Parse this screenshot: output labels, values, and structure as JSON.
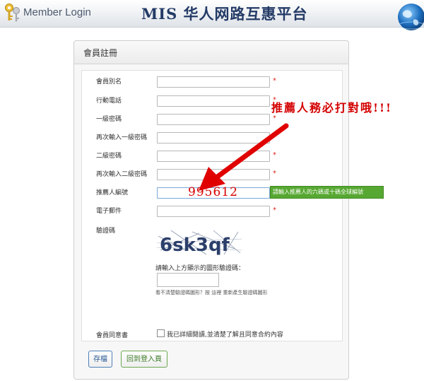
{
  "header": {
    "brand": "Member Login",
    "title": "MIS 华人网路互惠平台"
  },
  "panel": {
    "title": "會員註冊"
  },
  "form": {
    "fields": [
      {
        "label": "會員別名",
        "value": "",
        "required": "*"
      },
      {
        "label": "行動電話",
        "value": "",
        "required": "*"
      },
      {
        "label": "一級密碼",
        "value": "",
        "required": "*"
      },
      {
        "label": "再次輸入一級密碼",
        "value": "",
        "required": "*"
      },
      {
        "label": "二級密碼",
        "value": "",
        "required": "*"
      },
      {
        "label": "再次輸入二級密碼",
        "value": "",
        "required": "*"
      },
      {
        "label": "推薦人編號",
        "value": "995612",
        "required": ""
      },
      {
        "label": "電子郵件",
        "value": "",
        "required": "*"
      }
    ],
    "referral_tooltip": "請輸入推薦人的六碼或十碼全球編號",
    "captcha_label": "驗證碼",
    "captcha_text": "6sk3qf",
    "captcha_hint": "請輸入上方顯示的圖形驗證碼：",
    "captcha_refresh": "看不清楚驗證碼圖形？按 這裡 重新產生驗證碼圖形",
    "agree_label": "會員同意書",
    "agree_text": "我已詳細閱讀,並清楚了解且同意合約內容"
  },
  "buttons": {
    "save": "存檔",
    "back": "回到登入頁"
  },
  "annotation": {
    "text": "推薦人務必打對哦!!!"
  },
  "colors": {
    "required": "#d9261c",
    "annotation": "#d40000",
    "tooltip_bg": "#57a832",
    "title": "#233a66"
  }
}
